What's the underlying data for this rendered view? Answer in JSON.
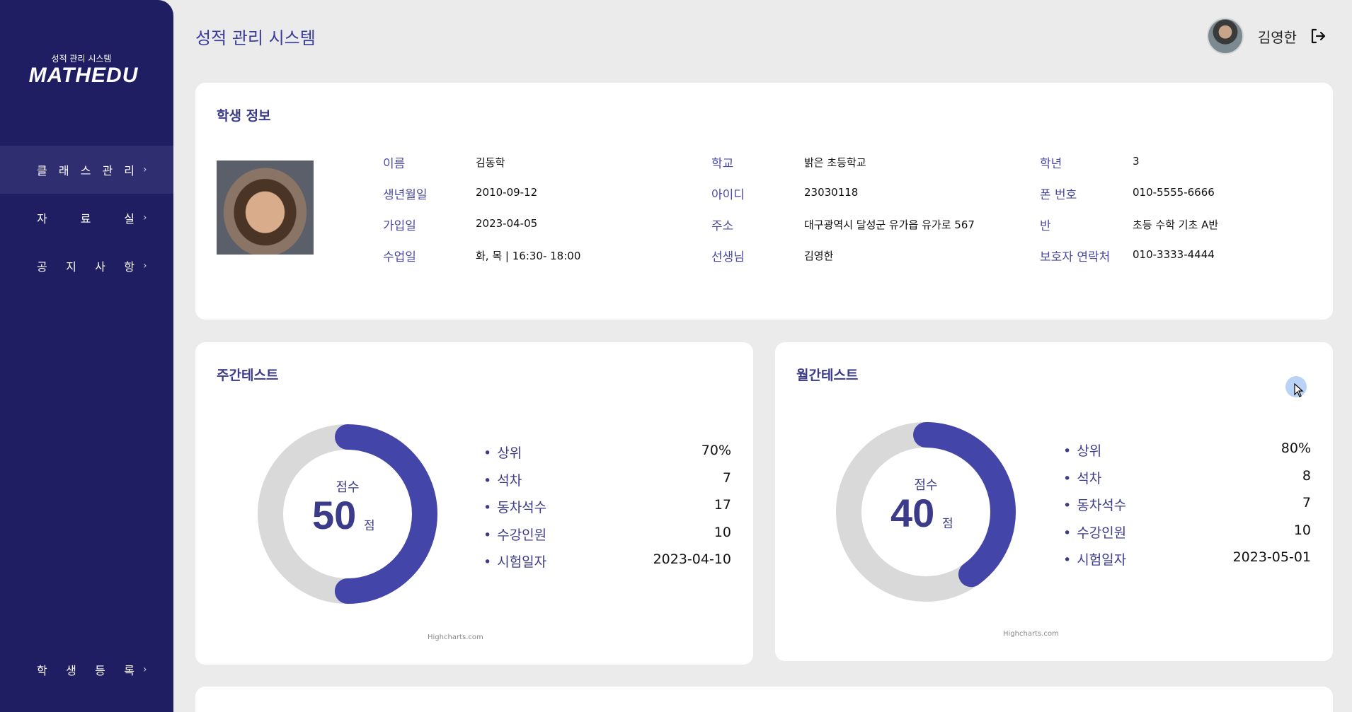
{
  "brand": {
    "subtitle": "성적 관리 시스템",
    "logo": "MATHEDU"
  },
  "sidebar": {
    "items": [
      {
        "label": [
          "클",
          "래",
          "스",
          "관",
          "리"
        ],
        "active": true
      },
      {
        "label": [
          "자",
          "료",
          "실"
        ],
        "active": false
      },
      {
        "label": [
          "공",
          "지",
          "사",
          "항"
        ],
        "active": false
      }
    ],
    "bottom_item": [
      "학",
      "생",
      "등",
      "록"
    ],
    "chevron": "›"
  },
  "header": {
    "title": "성적 관리 시스템",
    "user_name": "김영한"
  },
  "student": {
    "title": "학생 정보",
    "fields": [
      {
        "label": "이름",
        "value": "김동학"
      },
      {
        "label": "학교",
        "value": "밝은 초등학교"
      },
      {
        "label": "학년",
        "value": "3"
      },
      {
        "label": "생년월일",
        "value": "2010-09-12"
      },
      {
        "label": "아이디",
        "value": "23030118"
      },
      {
        "label": "폰 번호",
        "value": "010-5555-6666"
      },
      {
        "label": "가입일",
        "value": "2023-04-05"
      },
      {
        "label": "주소",
        "value": "대구광역시 달성군 유가읍 유가로 567"
      },
      {
        "label": "반",
        "value": "초등 수학 기초 A반"
      },
      {
        "label": "수업일",
        "value": "화, 목 | 16:30- 18:00"
      },
      {
        "label": "선생님",
        "value": "김영한"
      },
      {
        "label": "보호자 연락처",
        "value": "010-3333-4444"
      }
    ]
  },
  "weekly": {
    "title": "주간테스트",
    "score_label": "점수",
    "score": "50",
    "unit": "점",
    "fraction": 0.5,
    "stats": [
      {
        "label": "상위",
        "value": "70%"
      },
      {
        "label": "석차",
        "value": "7"
      },
      {
        "label": "동차석수",
        "value": "17"
      },
      {
        "label": "수강인원",
        "value": "10"
      },
      {
        "label": "시험일자",
        "value": "2023-04-10"
      }
    ],
    "credit": "Highcharts.com"
  },
  "monthly": {
    "title": "월간테스트",
    "score_label": "점수",
    "score": "40",
    "unit": "점",
    "fraction": 0.4,
    "stats": [
      {
        "label": "상위",
        "value": "80%"
      },
      {
        "label": "석차",
        "value": "8"
      },
      {
        "label": "동차석수",
        "value": "7"
      },
      {
        "label": "수강인원",
        "value": "10"
      },
      {
        "label": "시험일자",
        "value": "2023-05-01"
      }
    ],
    "credit": "Highcharts.com"
  },
  "colors": {
    "sidebar": "#1f1e63",
    "accent": "#4346a8",
    "track": "#d9d9d9"
  },
  "icons": {
    "logout": "logout-icon",
    "cursor": "cursor-icon"
  }
}
